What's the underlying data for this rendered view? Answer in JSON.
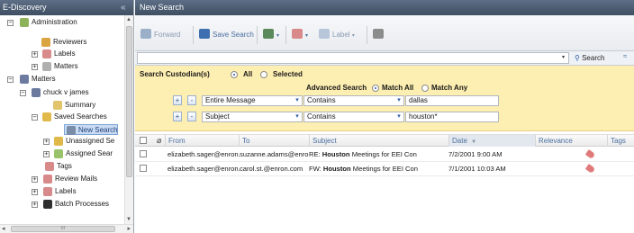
{
  "left_panel": {
    "title": "E-Discovery",
    "tree": [
      {
        "label": "Administration",
        "exp": "⊟",
        "icon": "globe-icon",
        "color": "#8fb35a"
      },
      {
        "label": "Reviewers",
        "exp": "",
        "icon": "users-icon",
        "color": "#d9a441"
      },
      {
        "label": "Labels",
        "exp": "⊞",
        "icon": "labels-icon",
        "color": "#d88a8a"
      },
      {
        "label": "Matters",
        "exp": "⊞",
        "icon": "matters-icon",
        "color": "#b0b0b0"
      },
      {
        "label": "Matters",
        "exp": "⊟",
        "icon": "scale-icon",
        "color": "#6c7aa0"
      },
      {
        "label": "chuck v james",
        "exp": "⊟",
        "icon": "case-icon",
        "color": "#6c7aa0"
      },
      {
        "label": "Summary",
        "exp": "",
        "icon": "summary-icon",
        "color": "#e2c46a"
      },
      {
        "label": "Saved Searches",
        "exp": "⊟",
        "icon": "folder-icon",
        "color": "#e0b94a"
      },
      {
        "label": "New Search",
        "exp": "",
        "icon": "search-doc-icon",
        "color": "#7a8da8",
        "selected": true
      },
      {
        "label": "Unassigned Se",
        "exp": "⊞",
        "icon": "folder-icon",
        "color": "#e0b94a"
      },
      {
        "label": "Assigned Sear",
        "exp": "⊞",
        "icon": "folder-icon",
        "color": "#9ac26a"
      },
      {
        "label": "Tags",
        "exp": "",
        "icon": "tags-icon",
        "color": "#d88a8a"
      },
      {
        "label": "Review Mails",
        "exp": "⊞",
        "icon": "labels-icon",
        "color": "#d88a8a"
      },
      {
        "label": "Labels",
        "exp": "⊞",
        "icon": "labels-icon",
        "color": "#d88a8a"
      },
      {
        "label": "Batch Processes",
        "exp": "⊞",
        "icon": "batch-icon",
        "color": "#2f2f2f"
      }
    ],
    "hscroll_label": "III"
  },
  "main": {
    "title": "New Search",
    "toolbar": {
      "forward": "Forward",
      "save_search": "Save Search",
      "label": "Label"
    },
    "search_bar": {
      "value": "",
      "search_button": "Search",
      "more": "≈"
    },
    "criteria": {
      "custodian_label": "Search Custodian(s)",
      "all_label": "All",
      "selected_label": "Selected",
      "advanced_label": "Advanced Search",
      "match_all_label": "Match All",
      "match_any_label": "Match Any",
      "rows": [
        {
          "field": "Entire Message",
          "op": "Contains",
          "value": "dallas"
        },
        {
          "field": "Subject",
          "op": "Contains",
          "value": "houston*"
        }
      ],
      "plus": "+",
      "minus": "-"
    },
    "grid": {
      "columns": [
        "From",
        "To",
        "Subject",
        "Date",
        "Relevance",
        "Tags"
      ],
      "sort_indicator": "▼",
      "rows": [
        {
          "from": "elizabeth.sager@enron.",
          "to": "suzanne.adams@enron.c",
          "subject_prefix": "RE: ",
          "subject_bold": "Houston",
          "subject_rest": " Meetings for EEI Con",
          "date": "7/2/2001 9:00 AM"
        },
        {
          "from": "elizabeth.sager@enron.",
          "to": "carol.st.@enron.com",
          "subject_prefix": "FW: ",
          "subject_bold": "Houston",
          "subject_rest": " Meetings for EEI Con",
          "date": "7/1/2001 10:03 AM"
        }
      ]
    }
  }
}
